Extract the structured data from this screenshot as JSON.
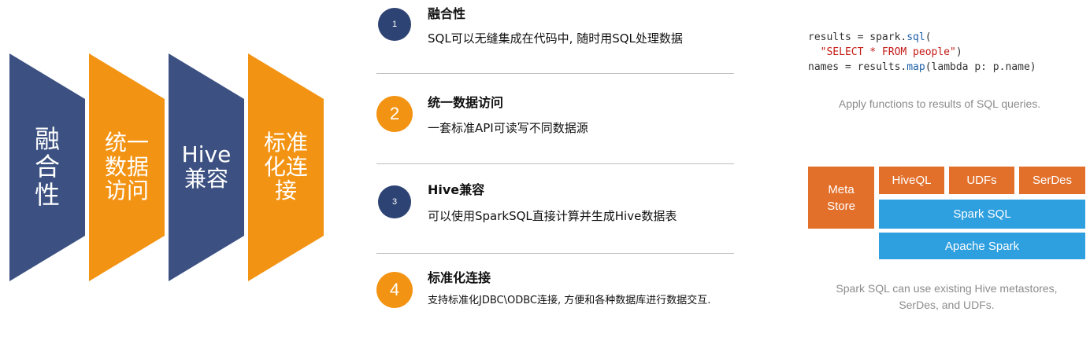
{
  "chevrons": [
    {
      "label": "融\n合\n性",
      "color": "#3c5182"
    },
    {
      "label": "统一\n数据\n访问",
      "color": "#f39313"
    },
    {
      "label": "Hive\n兼容",
      "color": "#3c5182"
    },
    {
      "label": "标准\n化连\n接",
      "color": "#f39313"
    }
  ],
  "features": [
    {
      "number": "1",
      "title": "融合性",
      "description": "SQL可以无缝集成在代码中, 随时用SQL处理数据",
      "badge_color": "#2d4373"
    },
    {
      "number": "2",
      "title": "统一数据访问",
      "description": "一套标准API可读写不同数据源",
      "badge_color": "#f39313"
    },
    {
      "number": "3",
      "title": "Hive兼容",
      "description": "可以使用SparkSQL直接计算并生成Hive数据表",
      "badge_color": "#2d4373"
    },
    {
      "number": "4",
      "title": "标准化连接",
      "description": "支持标准化JDBC\\ODBC连接, 方便和各种数据库进行数据交互.",
      "badge_color": "#f39313"
    }
  ],
  "code_example": {
    "line1_prefix": "results = spark.",
    "line1_fn": "sql",
    "line1_suffix": "(",
    "line2_string": "  \"SELECT * FROM people\"",
    "line2_suffix": ")",
    "line3_prefix": "names = results.",
    "line3_fn": "map",
    "line3_suffix": "(lambda p: p.name)",
    "caption": "Apply functions to results of SQL queries."
  },
  "architecture": {
    "metastore": "Meta\nStore",
    "hiveql": "HiveQL",
    "udfs": "UDFs",
    "serdes": "SerDes",
    "spark_sql": "Spark SQL",
    "apache_spark": "Apache Spark",
    "caption": "Spark SQL can use existing Hive metastores,\nSerDes, and UDFs.",
    "colors": {
      "orange": "#e2702b",
      "blue": "#2e9fdf"
    }
  }
}
